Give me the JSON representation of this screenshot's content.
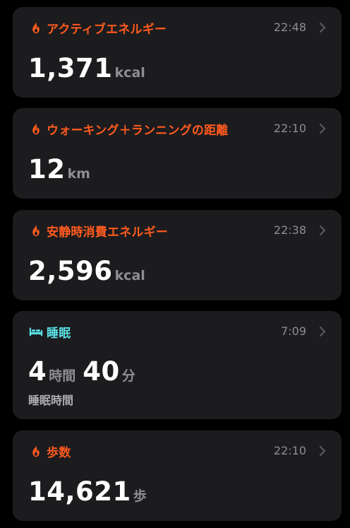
{
  "colors": {
    "activity": "#ff5a1f",
    "sleep": "#5ae0e6",
    "time_text": "#8e8e93",
    "card_bg": "#1c1c1e"
  },
  "cards": [
    {
      "icon": "flame-icon",
      "title": "アクティブエネルギー",
      "time": "22:48",
      "value": "1,371",
      "unit": "kcal"
    },
    {
      "icon": "flame-icon",
      "title": "ウォーキング＋ランニングの距離",
      "time": "22:10",
      "value": "12",
      "unit": "km"
    },
    {
      "icon": "flame-icon",
      "title": "安静時消費エネルギー",
      "time": "22:38",
      "value": "2,596",
      "unit": "kcal"
    },
    {
      "icon": "bed-icon",
      "title": "睡眠",
      "time": "7:09",
      "hours": "4",
      "hours_unit": "時間",
      "minutes": "40",
      "minutes_unit": "分",
      "subtitle": "睡眠時間"
    },
    {
      "icon": "flame-icon",
      "title": "歩数",
      "time": "22:10",
      "value": "14,621",
      "unit": "歩"
    }
  ]
}
